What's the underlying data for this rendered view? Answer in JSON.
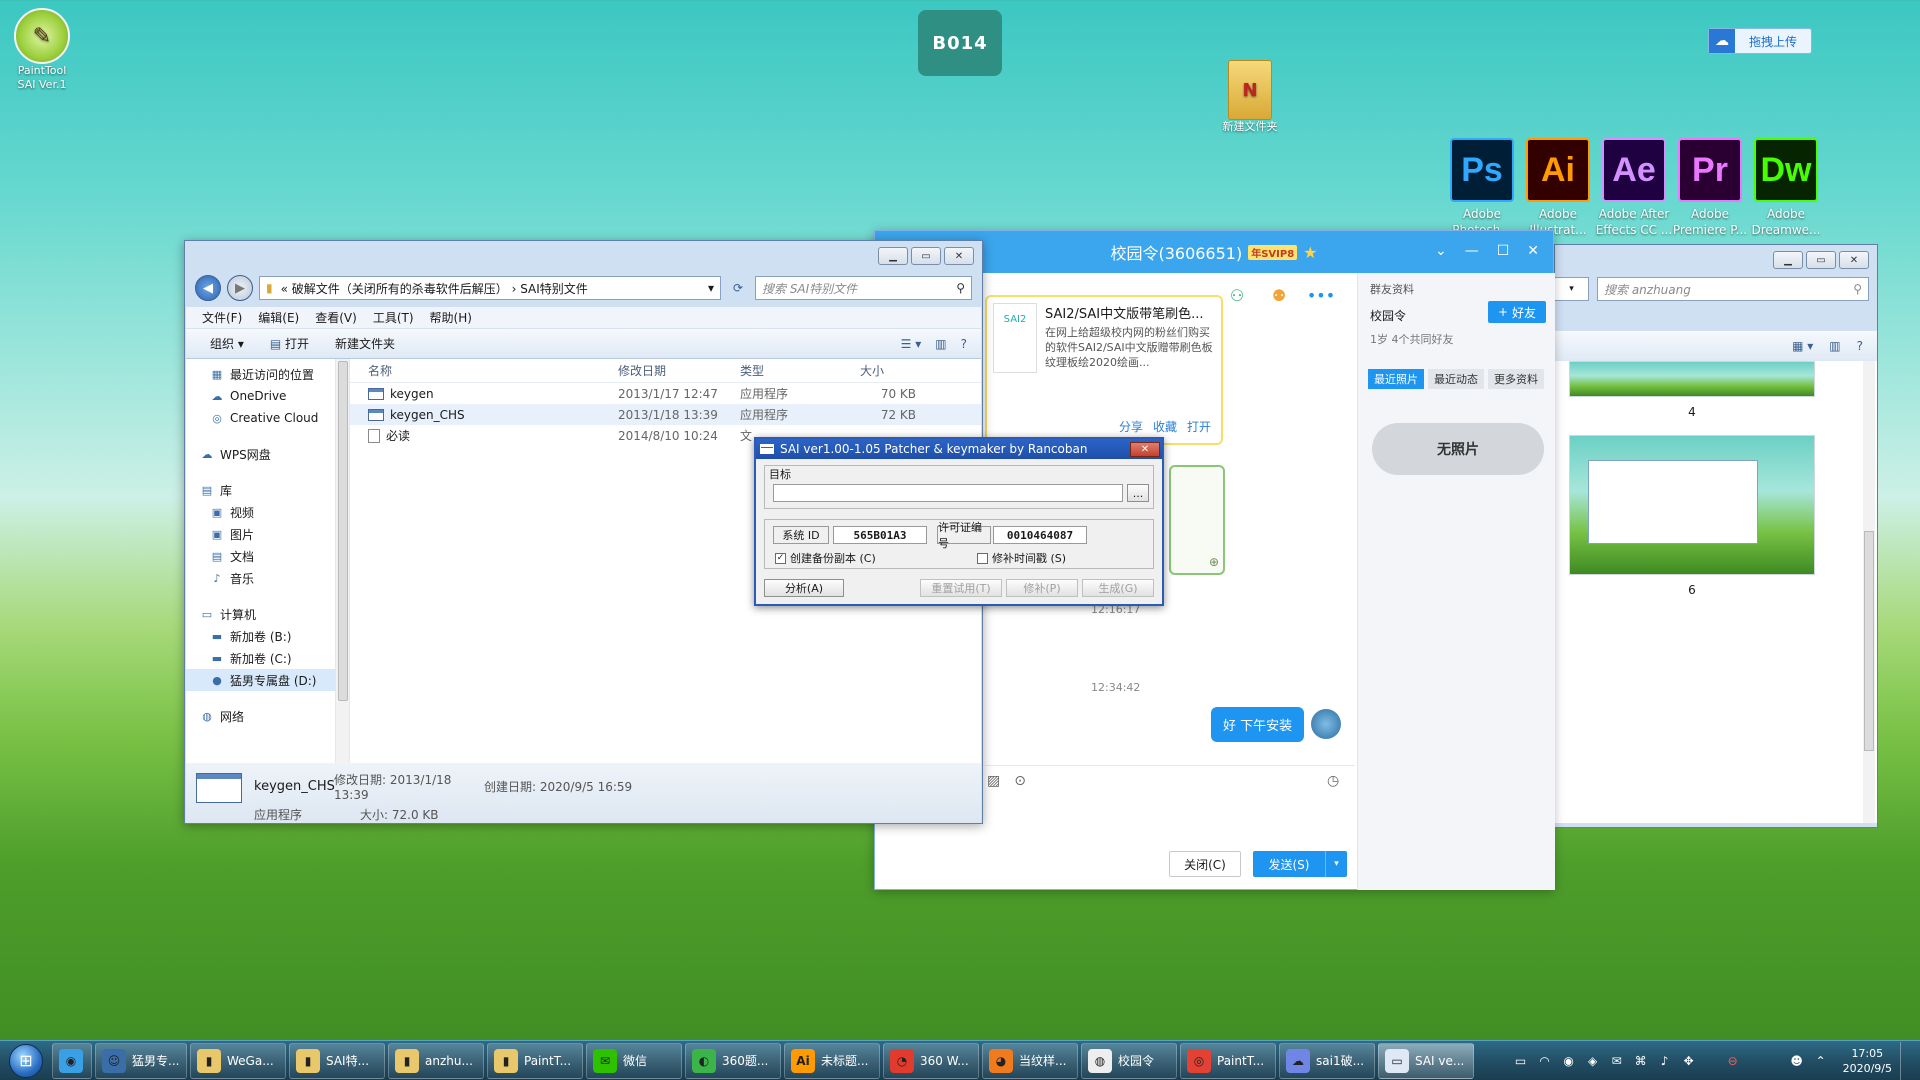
{
  "desktop": {
    "painttool": {
      "line1": "PaintTool",
      "line2": "SAI Ver.1"
    },
    "badge": "B014",
    "new_folder": "新建文件夹",
    "upload_label": "拖拽上传",
    "adobe_apps": [
      {
        "abbr": "Ps",
        "name": "Adobe Photosh...",
        "fg": "#31a8ff",
        "bg": "#001e36"
      },
      {
        "abbr": "Ai",
        "name": "Adobe Illustrat...",
        "fg": "#ff9a00",
        "bg": "#330000"
      },
      {
        "abbr": "Ae",
        "name": "Adobe After Effects CC ...",
        "fg": "#d291ff",
        "bg": "#1f0040"
      },
      {
        "abbr": "Pr",
        "name": "Adobe Premiere P...",
        "fg": "#ea77ff",
        "bg": "#2a0033"
      },
      {
        "abbr": "Dw",
        "name": "Adobe Dreamwe...",
        "fg": "#46ff00",
        "bg": "#072401"
      }
    ]
  },
  "explorer": {
    "breadcrumb": "« 破解文件（关闭所有的杀毒软件后解压） › SAI特别文件",
    "search_placeholder": "搜索 SAI特别文件",
    "menu": [
      "文件(F)",
      "编辑(E)",
      "查看(V)",
      "工具(T)",
      "帮助(H)"
    ],
    "toolbar": {
      "organize": "组织 ▾",
      "open": "打开",
      "new_folder": "新建文件夹"
    },
    "nav": [
      {
        "label": "最近访问的位置",
        "icon": "▦",
        "level": 2
      },
      {
        "label": "OneDrive",
        "icon": "☁",
        "level": 2
      },
      {
        "label": "Creative Cloud",
        "icon": "◎",
        "level": 2
      },
      {
        "label": "WPS网盘",
        "icon": "☁",
        "level": 1,
        "gap": true
      },
      {
        "label": "库",
        "icon": "▤",
        "level": 1,
        "gap": true
      },
      {
        "label": "视频",
        "icon": "▣",
        "level": 2
      },
      {
        "label": "图片",
        "icon": "▣",
        "level": 2
      },
      {
        "label": "文档",
        "icon": "▤",
        "level": 2
      },
      {
        "label": "音乐",
        "icon": "♪",
        "level": 2
      },
      {
        "label": "计算机",
        "icon": "▭",
        "level": 1,
        "gap": true
      },
      {
        "label": "新加卷 (B:)",
        "icon": "▬",
        "level": 2
      },
      {
        "label": "新加卷 (C:)",
        "icon": "▬",
        "level": 2
      },
      {
        "label": "猛男专属盘 (D:)",
        "icon": "●",
        "level": 2,
        "selected": true
      },
      {
        "label": "网络",
        "icon": "◍",
        "level": 1,
        "gap": true
      }
    ],
    "columns": {
      "name": "名称",
      "date": "修改日期",
      "type": "类型",
      "size": "大小"
    },
    "files": [
      {
        "name": "keygen",
        "date": "2013/1/17 12:47",
        "type": "应用程序",
        "size": "70 KB",
        "kind": "exe"
      },
      {
        "name": "keygen_CHS",
        "date": "2013/1/18 13:39",
        "type": "应用程序",
        "size": "72 KB",
        "kind": "exe",
        "selected": true
      },
      {
        "name": "必读",
        "date": "2014/8/10 10:24",
        "type": "文",
        "size": "",
        "kind": "doc"
      }
    ],
    "details": {
      "name": "keygen_CHS",
      "modified": "修改日期: 2013/1/18 13:39",
      "created": "创建日期: 2020/9/5 16:59",
      "type": "应用程序",
      "size": "大小: 72.0 KB"
    }
  },
  "patcher": {
    "title": "SAI ver1.00-1.05 Patcher & keymaker by Rancoban",
    "target_label": "目标",
    "browse": "...",
    "system_id_label": "系统 ID",
    "system_id": "565B01A3",
    "license_label": "许可证编号",
    "license": "0010464087",
    "backup_label": "创建备份副本 (C)",
    "patch_time_label": "修补时间戳 (S)",
    "analyze": "分析(A)",
    "reset_trial": "重置试用(T)",
    "patch": "修补(P)",
    "generate": "生成(G)"
  },
  "qq": {
    "title": "校园令(3606651)",
    "svip": "年SVIP8",
    "card": {
      "thumb": "SAI2",
      "title": "SAI2/SAI中文版带笔刷色...",
      "desc": "在网上给超级校内网的粉丝们购买的软件SAI2/SAI中文版赠带刷色板纹理板绘2020绘画...",
      "links": [
        "分享",
        "收藏",
        "打开"
      ]
    },
    "timestamps": [
      "12:16:17",
      "12:34:42"
    ],
    "message": "好 下午安装",
    "close_button": "关闭(C)",
    "send_button": "发送(S)",
    "side": {
      "header": "群友资料",
      "name": "校园令",
      "add_friend": "好友",
      "sub": "1岁 4个共同好友",
      "tabs": [
        "最近照片",
        "最近动态",
        "更多资料"
      ],
      "no_photo": "无照片"
    }
  },
  "right_explorer": {
    "addr_fragment": "▾",
    "search_placeholder": "搜索 anzhuang",
    "thumb_labels": [
      "4",
      "6"
    ]
  },
  "taskbar": {
    "items": [
      {
        "label": "",
        "icon": "◉",
        "color": "#3aa0e6",
        "w": 40
      },
      {
        "label": "猛男专...",
        "icon": "☺",
        "color": "#3b6ea8",
        "w": 92
      },
      {
        "label": "WeGa...",
        "icon": "▮",
        "color": "#e8c86a",
        "w": 96
      },
      {
        "label": "SAI特...",
        "icon": "▮",
        "color": "#e8c86a",
        "w": 96
      },
      {
        "label": "anzhu...",
        "icon": "▮",
        "color": "#e8c86a",
        "w": 96
      },
      {
        "label": "PaintT...",
        "icon": "▮",
        "color": "#e8c86a",
        "w": 96
      },
      {
        "label": "微信",
        "icon": "✉",
        "color": "#2dc100",
        "w": 96
      },
      {
        "label": "360题...",
        "icon": "◐",
        "color": "#3bb54a",
        "w": 96
      },
      {
        "label": "未标题...",
        "icon": "Ai",
        "color": "#ff9a00",
        "w": 96
      },
      {
        "label": "360 W...",
        "icon": "◔",
        "color": "#e23b2e",
        "w": 96
      },
      {
        "label": "当纹样...",
        "icon": "◕",
        "color": "#f07a1e",
        "w": 96
      },
      {
        "label": "校园令",
        "icon": "◍",
        "color": "#eeeeee",
        "w": 96
      },
      {
        "label": "PaintT...",
        "icon": "◎",
        "color": "#e34133",
        "w": 96
      },
      {
        "label": "sai1破...",
        "icon": "☁",
        "color": "#6f86e6",
        "w": 96
      },
      {
        "label": "SAI ve...",
        "icon": "▭",
        "color": "#dfe8f5",
        "w": 96,
        "active": true
      }
    ],
    "time": "17:05",
    "date": "2020/9/5"
  }
}
